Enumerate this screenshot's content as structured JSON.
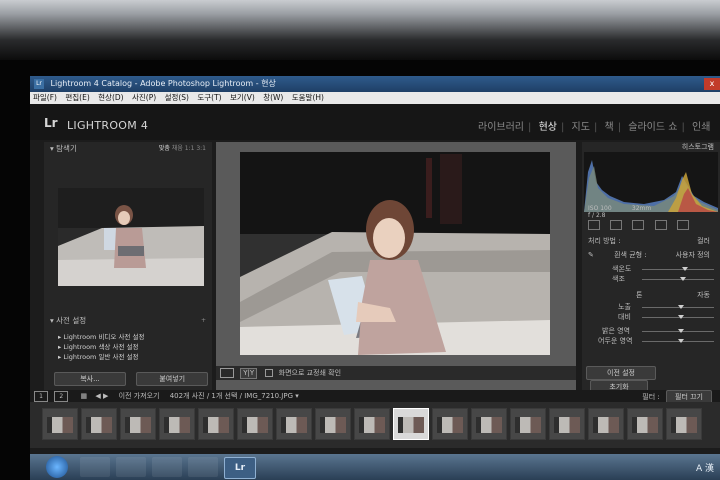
{
  "window": {
    "title": "Lightroom 4 Catalog - Adobe Photoshop Lightroom - 현상",
    "close_glyph": "x"
  },
  "menu": [
    "파일(F)",
    "편집(E)",
    "현상(D)",
    "사진(P)",
    "설정(S)",
    "도구(T)",
    "보기(V)",
    "창(W)",
    "도움말(H)"
  ],
  "identity": {
    "logo": "Lr",
    "name": "LIGHTROOM 4"
  },
  "modules": [
    {
      "label": "라이브러리",
      "active": false
    },
    {
      "label": "현상",
      "active": true
    },
    {
      "label": "지도",
      "active": false
    },
    {
      "label": "책",
      "active": false
    },
    {
      "label": "슬라이드 쇼",
      "active": false
    },
    {
      "label": "인쇄",
      "active": false
    }
  ],
  "left_panel": {
    "navigator": {
      "title": "탐색기",
      "zoom_fit": "맞춤",
      "zoom_fill": "채움",
      "zoom_1": "1:1",
      "zoom_3": "3:1"
    },
    "presets": {
      "title": "사전 설정",
      "add_glyph": "+",
      "items": [
        "Lightroom 비디오 사전 설정",
        "Lightroom 색상 사전 설정",
        "Lightroom 일반 사전 설정"
      ]
    },
    "copy_button": "복사...",
    "paste_button": "붙여넣기"
  },
  "toolbar": {
    "yy_label": "Y|Y",
    "softproof_label": "화면으로 교정쇄 확인"
  },
  "right_panel": {
    "histogram_title": "히스토그램",
    "exif": {
      "iso": "ISO 100",
      "focal": "32mm",
      "aperture": "f / 2.8"
    },
    "treatment_label": "처리 방법 :",
    "treatment_value": "컬러",
    "wb_label": "흰색 균형 :",
    "wb_value": "사용자 정의",
    "temp_label": "색온도",
    "tint_label": "색조",
    "tone_label": "톤",
    "auto_label": "자동",
    "exposure_label": "노출",
    "contrast_label": "대비",
    "highlights_label": "밝은 영역",
    "shadows_label": "어두운 영역",
    "prev_button": "이전 설정",
    "reset_button": "초기화"
  },
  "filter": {
    "screen1": "1",
    "screen2": "2",
    "source": "이전 가져오기",
    "info": "402개 사진 / 1개 선택 / IMG_7210.JPG",
    "filter_label": "필터 :",
    "filter_value": "필터 끄기"
  },
  "filmstrip": {
    "count": 17,
    "selected_index": 9
  },
  "taskbar": {
    "lr_label": "Lr",
    "tray_text": "A 漢"
  },
  "colors": {
    "panel_bg": "#262626",
    "center_bg": "#5a5a5a",
    "titlebar": "#2f5b8c",
    "active_module": "#f0f0f0"
  }
}
